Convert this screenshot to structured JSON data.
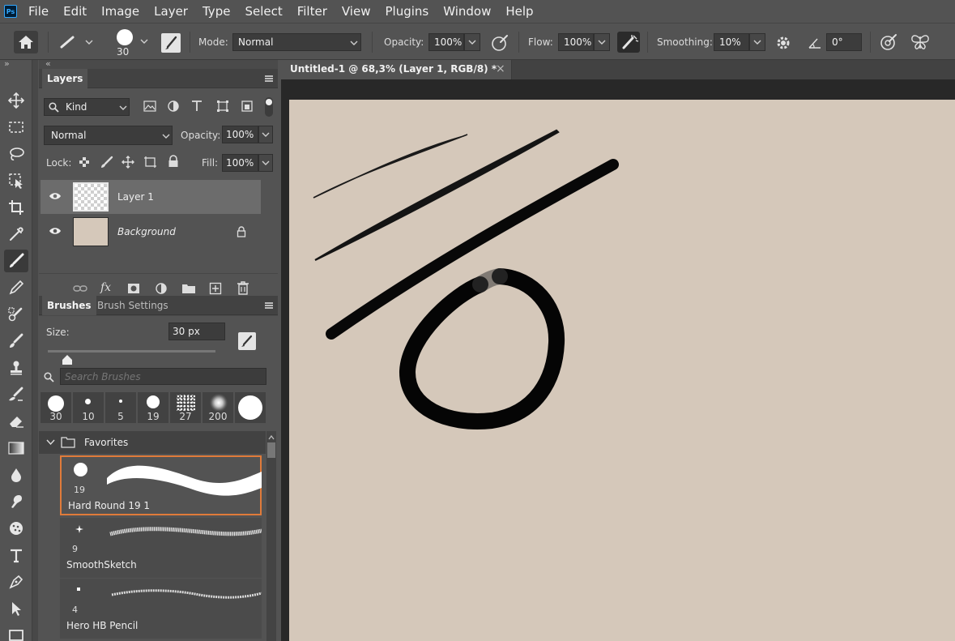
{
  "menu": {
    "logo": "Ps",
    "items": [
      "File",
      "Edit",
      "Image",
      "Layer",
      "Type",
      "Select",
      "Filter",
      "View",
      "Plugins",
      "Window",
      "Help"
    ]
  },
  "options": {
    "brush_size": "30",
    "mode_label": "Mode:",
    "mode_value": "Normal",
    "opacity_label": "Opacity:",
    "opacity_value": "100%",
    "flow_label": "Flow:",
    "flow_value": "100%",
    "smoothing_label": "Smoothing:",
    "smoothing_value": "10%",
    "angle_value": "0°"
  },
  "toolbar": {
    "collapse": "»",
    "tools": [
      "move-tool",
      "marquee-tool",
      "lasso-tool",
      "object-select-tool",
      "crop-tool",
      "eyedropper-tool",
      "brush-tool",
      "pencil-tool",
      "healing-brush-tool",
      "history-brush-tool",
      "clone-stamp-tool",
      "mixer-brush-tool",
      "eraser-tool",
      "gradient-tool",
      "blur-tool",
      "smudge-tool",
      "sponge-tool",
      "type-tool",
      "pen-tool",
      "path-select-tool",
      "rectangle-tool"
    ],
    "active_tool": "brush-tool"
  },
  "layers_panel": {
    "collapse": "«",
    "tab": "Layers",
    "filter_kind": "Kind",
    "blend_mode": "Normal",
    "opacity_label": "Opacity:",
    "opacity_value": "100%",
    "lock_label": "Lock:",
    "fill_label": "Fill:",
    "fill_value": "100%",
    "layers": [
      {
        "name": "Layer 1",
        "selected": true
      },
      {
        "name": "Background",
        "selected": false,
        "locked": true
      }
    ]
  },
  "brushes_panel": {
    "tabs": [
      "Brushes",
      "Brush Settings"
    ],
    "size_label": "Size:",
    "size_value": "30 px",
    "size_fraction": 0.06,
    "search_placeholder": "Search Brushes",
    "presets": [
      "30",
      "10",
      "5",
      "19",
      "27",
      "200",
      ""
    ],
    "group_name": "Favorites",
    "brushes": [
      {
        "size": "19",
        "name": "Hard Round 19 1"
      },
      {
        "size": "9",
        "name": "SmoothSketch"
      },
      {
        "size": "4",
        "name": "Hero HB Pencil"
      }
    ]
  },
  "document": {
    "tab_title": "Untitled-1 @ 68,3% (Layer 1, RGB/8) *",
    "close": "×",
    "canvas_color": "#d5c8ba"
  }
}
